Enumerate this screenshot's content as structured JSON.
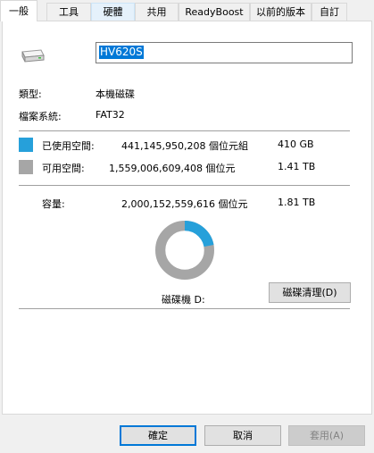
{
  "tabs": [
    {
      "label": "一般",
      "active": true
    },
    {
      "label": "工具"
    },
    {
      "label": "硬體"
    },
    {
      "label": "共用"
    },
    {
      "label": "ReadyBoost"
    },
    {
      "label": "以前的版本"
    },
    {
      "label": "自訂"
    }
  ],
  "drive": {
    "icon": "drive-icon",
    "name_value": "HV620S",
    "type_label": "類型:",
    "type_value": "本機磁碟",
    "fs_label": "檔案系統:",
    "fs_value": "FAT32"
  },
  "space": {
    "used_label": "已使用空間:",
    "used_bytes": "441,145,950,208 個位元組",
    "used_size": "410 GB",
    "used_color": "#26a0da",
    "free_label": "可用空間:",
    "free_bytes": "1,559,006,609,408 個位元",
    "free_size": "1.41 TB",
    "free_color": "#a6a6a6",
    "capacity_label": "容量:",
    "capacity_bytes": "2,000,152,559,616 個位元",
    "capacity_size": "1.81 TB",
    "used_fraction": 0.2206
  },
  "drive_label": "磁碟機 D:",
  "cleanup_button": "磁碟清理(D)",
  "footer": {
    "ok": "確定",
    "cancel": "取消",
    "apply": "套用(A)"
  }
}
